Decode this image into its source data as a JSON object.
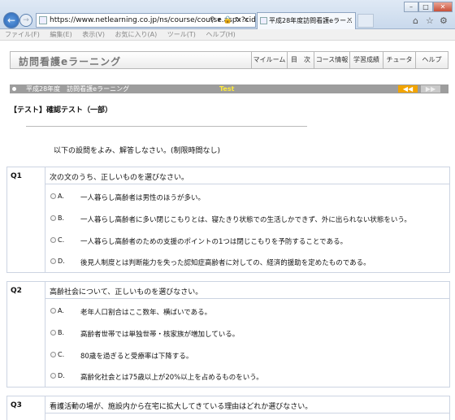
{
  "browser": {
    "url": "https://www.netlearning.co.jp/ns/course/course.aspx?cid=5",
    "tab_title": "平成28年度訪問看護eラー...",
    "tab_close": "×",
    "menu": [
      "ファイル(F)",
      "編集(E)",
      "表示(V)",
      "お気に入り(A)",
      "ツール(T)",
      "ヘルプ(H)"
    ],
    "window_controls": [
      "–",
      "□",
      "✕"
    ]
  },
  "site": {
    "logo": "訪問看護eラーニング",
    "nav": [
      "マイルーム",
      "目　次",
      "コース情報",
      "学習成績",
      "チュータ",
      "ヘルプ"
    ]
  },
  "status": {
    "breadcrumb": "平成28年度　訪問看護eラーニング",
    "mode": "Test",
    "prev_arrow": "◀◀",
    "next_arrow": "▶▶"
  },
  "test": {
    "title": "【テスト】確認テスト（一部）",
    "instruction": "以下の設問をよみ、解答しなさい。(制限時間なし)"
  },
  "questions": [
    {
      "number": "Q1",
      "text": "次の文のうち、正しいものを選びなさい。",
      "options": [
        {
          "label": "A.",
          "text": "一人暮らし高齢者は男性のほうが多い。"
        },
        {
          "label": "B.",
          "text": "一人暮らし高齢者に多い閉じこもりとは、寝たきり状態での生活しかできず、外に出られない状態をいう。"
        },
        {
          "label": "C.",
          "text": "一人暮らし高齢者のための支援のポイントの1つは閉じこもりを予防することである。"
        },
        {
          "label": "D.",
          "text": "後見人制度とは判断能力を失った認知症高齢者に対しての、経済的援助を定めたものである。"
        }
      ]
    },
    {
      "number": "Q2",
      "text": "高齢社会について、正しいものを選びなさい。",
      "options": [
        {
          "label": "A.",
          "text": "老年人口割合はここ数年、横ばいである。"
        },
        {
          "label": "B.",
          "text": "高齢者世帯では単独世帯・核家族が増加している。"
        },
        {
          "label": "C.",
          "text": "80歳を過ぎると受療率は下降する。"
        },
        {
          "label": "D.",
          "text": "高齢化社会とは75歳以上が20%以上を占めるものをいう。"
        }
      ]
    },
    {
      "number": "Q3",
      "text": "看護活動の場が、施設内から在宅に拡大してきている理由はどれか選びなさい。",
      "options": []
    }
  ]
}
